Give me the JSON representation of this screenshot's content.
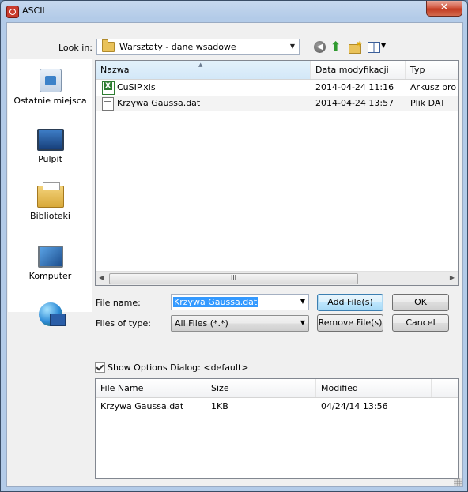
{
  "window": {
    "title": "ASCII",
    "close_label": "✕"
  },
  "toolbar": {
    "look_in_label": "Look in:",
    "look_in_value": "Warsztaty - dane wsadowe",
    "icons": [
      "back-icon",
      "up-folder-icon",
      "new-folder-icon",
      "views-menu-icon"
    ]
  },
  "places": [
    {
      "label": "Ostatnie miejsca",
      "icon": "recent-places-icon"
    },
    {
      "label": "Pulpit",
      "icon": "desktop-icon"
    },
    {
      "label": "Biblioteki",
      "icon": "libraries-icon"
    },
    {
      "label": "Komputer",
      "icon": "computer-icon"
    },
    {
      "label": "",
      "icon": "network-icon"
    }
  ],
  "file_list": {
    "columns": [
      "Nazwa",
      "Data modyfikacji",
      "Typ"
    ],
    "rows": [
      {
        "name": "CuSIP.xls",
        "date": "2014-04-24 11:16",
        "type": "Arkusz pro",
        "icon": "excel-file-icon"
      },
      {
        "name": "Krzywa Gaussa.dat",
        "date": "2014-04-24 13:57",
        "type": "Plik DAT",
        "icon": "dat-file-icon"
      }
    ],
    "scroll_grip": "III"
  },
  "form": {
    "file_name_label": "File name:",
    "file_name_value": "Krzywa Gaussa.dat",
    "file_type_label": "Files of type:",
    "file_type_value": "All Files (*.*)"
  },
  "buttons": {
    "add": "Add File(s)",
    "ok": "OK",
    "remove": "Remove File(s)",
    "cancel": "Cancel"
  },
  "options": {
    "show_dialog_label": "Show Options Dialog: <default>",
    "checked": true
  },
  "selected_files": {
    "columns": [
      "File Name",
      "Size",
      "Modified"
    ],
    "rows": [
      {
        "name": "Krzywa Gaussa.dat",
        "size": "1KB",
        "modified": "04/24/14 13:56"
      }
    ]
  }
}
